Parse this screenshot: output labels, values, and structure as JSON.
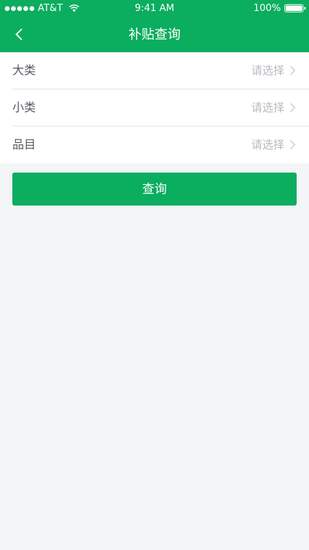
{
  "status_bar": {
    "carrier": "AT&T",
    "time": "9:41 AM",
    "battery": "100%"
  },
  "header": {
    "title": "补贴查询"
  },
  "form": {
    "rows": [
      {
        "label": "大类",
        "value": "请选择"
      },
      {
        "label": "小类",
        "value": "请选择"
      },
      {
        "label": "品目",
        "value": "请选择"
      }
    ]
  },
  "actions": {
    "query_label": "查询"
  },
  "colors": {
    "brand": "#0bad5f",
    "background": "#f4f5f7",
    "label": "#555a62",
    "placeholder": "#b7babf"
  },
  "icons": [
    "signal-icon",
    "wifi-icon",
    "battery-icon",
    "back-icon",
    "chevron-right-icon"
  ]
}
